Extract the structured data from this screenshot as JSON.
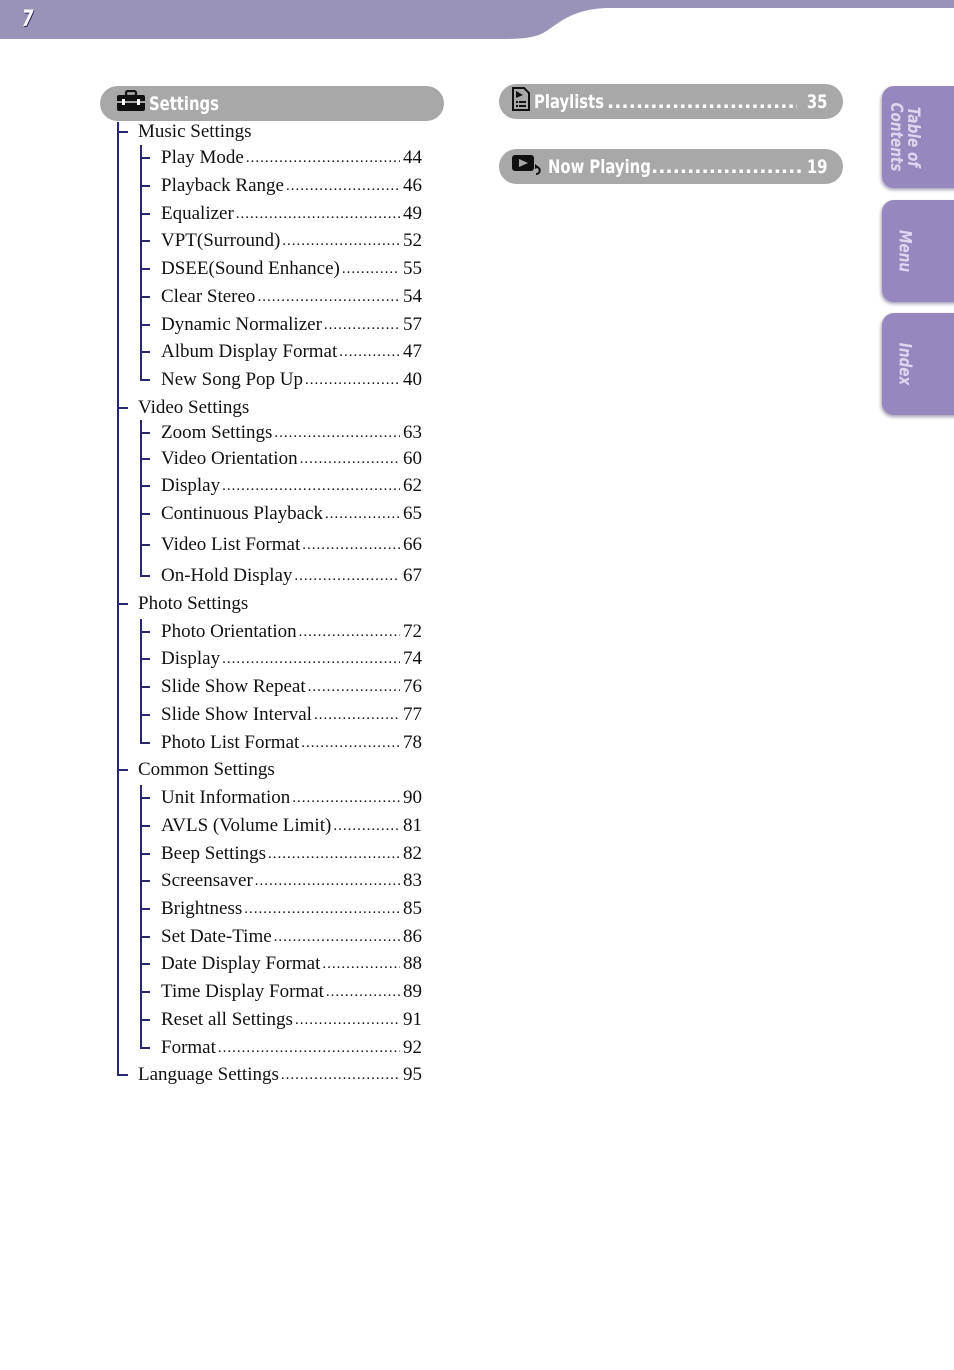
{
  "header": {
    "page_number": "7",
    "band_color": "#9a93b8"
  },
  "settings_section": {
    "title": "Settings",
    "icon": "toolbox-icon",
    "groups": [
      {
        "label": "Music Settings",
        "items": [
          {
            "label": "Play Mode",
            "page": "44"
          },
          {
            "label": "Playback Range",
            "page": "46"
          },
          {
            "label": "Equalizer",
            "page": "49"
          },
          {
            "label": "VPT(Surround)",
            "page": "52"
          },
          {
            "label": "DSEE(Sound Enhance)",
            "page": "55"
          },
          {
            "label": "Clear Stereo",
            "page": "54"
          },
          {
            "label": "Dynamic Normalizer",
            "page": "57"
          },
          {
            "label": "Album Display Format",
            "page": "47"
          },
          {
            "label": "New Song Pop Up",
            "page": "40"
          }
        ]
      },
      {
        "label": "Video Settings",
        "items": [
          {
            "label": "Zoom Settings",
            "page": "63"
          },
          {
            "label": "Video Orientation",
            "page": "60"
          },
          {
            "label": "Display",
            "page": "62"
          },
          {
            "label": "Continuous Playback",
            "page": "65"
          },
          {
            "label": "Video List Format",
            "page": "66"
          },
          {
            "label": "On-Hold Display",
            "page": "67"
          }
        ]
      },
      {
        "label": "Photo Settings",
        "items": [
          {
            "label": "Photo Orientation",
            "page": "72"
          },
          {
            "label": "Display",
            "page": "74"
          },
          {
            "label": "Slide Show Repeat",
            "page": "76"
          },
          {
            "label": "Slide Show Interval",
            "page": "77"
          },
          {
            "label": "Photo List Format",
            "page": "78"
          }
        ]
      },
      {
        "label": "Common Settings",
        "items": [
          {
            "label": "Unit Information",
            "page": "90"
          },
          {
            "label": "AVLS (Volume Limit)",
            "page": "81"
          },
          {
            "label": "Beep Settings",
            "page": "82"
          },
          {
            "label": "Screensaver",
            "page": "83"
          },
          {
            "label": "Brightness",
            "page": "85"
          },
          {
            "label": "Set Date-Time",
            "page": "86"
          },
          {
            "label": "Date Display Format",
            "page": "88"
          },
          {
            "label": "Time Display Format",
            "page": "89"
          },
          {
            "label": "Reset all Settings",
            "page": "91"
          },
          {
            "label": "Format",
            "page": "92"
          }
        ]
      }
    ],
    "language": {
      "label": "Language Settings",
      "page": "95"
    }
  },
  "right_sections": [
    {
      "title": "Playlists",
      "page": "35",
      "icon": "playlist-icon"
    },
    {
      "title": "Now Playing",
      "page": "19",
      "icon": "now-playing-icon"
    }
  ],
  "side_tabs": [
    {
      "label": "Table of\nContents"
    },
    {
      "label": "Menu"
    },
    {
      "label": "Index"
    }
  ],
  "colors": {
    "pill_gray": "#a8a8a8",
    "tree_line": "#2b2670",
    "tab_purple": "#9787bf"
  }
}
